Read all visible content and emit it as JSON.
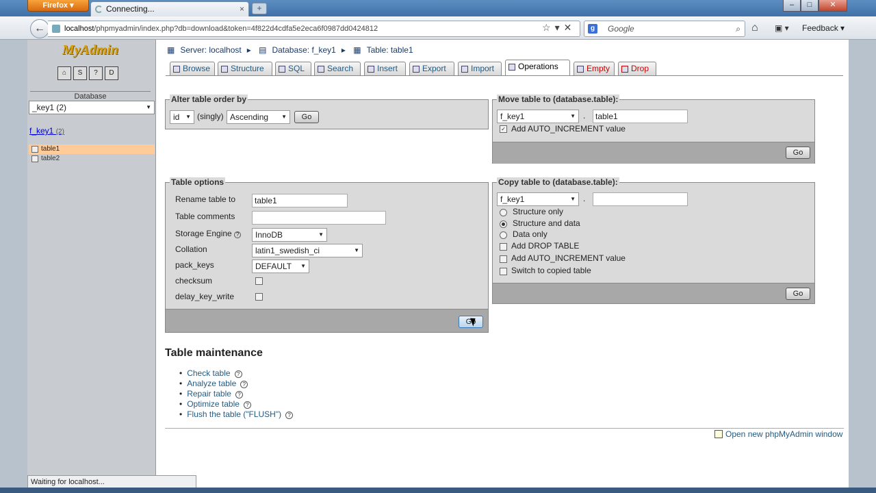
{
  "browser": {
    "menu_button": "Firefox",
    "tab_title": "Connecting...",
    "url_domain": "localhost",
    "url_path": "/phpmyadmin/index.php?db=download&token=4f822d4cdfa5e2eca6f0987dd0424812",
    "search_placeholder": "Google",
    "search_engine_icon": "g",
    "feedback_label": "Feedback",
    "status_text": "Waiting for localhost..."
  },
  "sidebar": {
    "logo": "MyAdmin",
    "database_label": "Database",
    "database_select": "_key1 (2)",
    "db_link": "f_key1",
    "db_count": "(2)",
    "tables": [
      "table1",
      "table2"
    ]
  },
  "breadcrumb": {
    "server": "Server: localhost",
    "database": "Database: f_key1",
    "table": "Table: table1"
  },
  "tabs": [
    "Browse",
    "Structure",
    "SQL",
    "Search",
    "Insert",
    "Export",
    "Import",
    "Operations",
    "Empty",
    "Drop"
  ],
  "alter_order": {
    "legend": "Alter table order by",
    "column": "id",
    "singly": "(singly)",
    "direction": "Ascending",
    "go": "Go"
  },
  "move_table": {
    "legend": "Move table to (database.table):",
    "database": "f_key1",
    "sep": ".",
    "table": "table1",
    "auto_inc": "Add AUTO_INCREMENT value",
    "go": "Go"
  },
  "table_options": {
    "legend": "Table options",
    "rename_label": "Rename table to",
    "rename_value": "table1",
    "comments_label": "Table comments",
    "comments_value": "",
    "engine_label": "Storage Engine",
    "engine_value": "InnoDB",
    "collation_label": "Collation",
    "collation_value": "latin1_swedish_ci",
    "pack_keys_label": "pack_keys",
    "pack_keys_value": "DEFAULT",
    "checksum_label": "checksum",
    "delay_key_label": "delay_key_write",
    "go": "Go"
  },
  "copy_table": {
    "legend": "Copy table to (database.table):",
    "database": "f_key1",
    "sep": ".",
    "table": "",
    "opt_structure": "Structure only",
    "opt_structure_data": "Structure and data",
    "opt_data": "Data only",
    "drop": "Add DROP TABLE",
    "auto_inc": "Add AUTO_INCREMENT value",
    "switch": "Switch to copied table",
    "go": "Go"
  },
  "maintenance": {
    "title": "Table maintenance",
    "items": [
      "Check table",
      "Analyze table",
      "Repair table",
      "Optimize table",
      "Flush the table (\"FLUSH\")"
    ]
  },
  "footer": {
    "open_window": "Open new phpMyAdmin window"
  }
}
